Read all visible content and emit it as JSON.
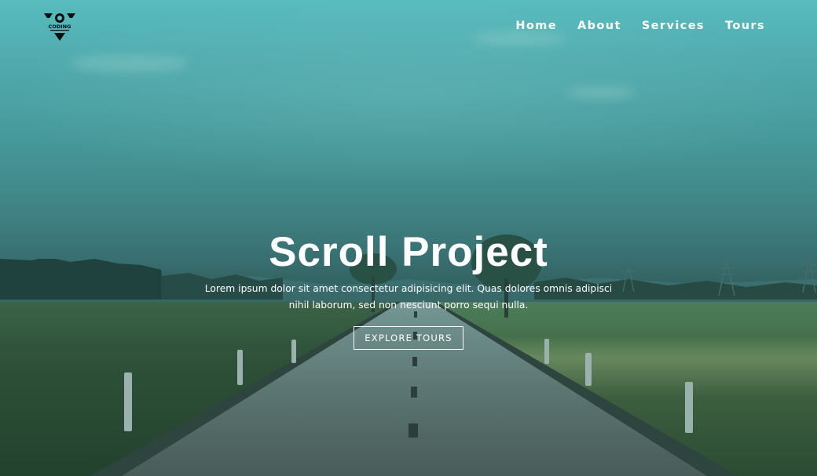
{
  "brand": {
    "logo_text": "CODING"
  },
  "nav": {
    "items": [
      {
        "label": "Home"
      },
      {
        "label": "About"
      },
      {
        "label": "Services"
      },
      {
        "label": "Tours"
      }
    ]
  },
  "hero": {
    "title": "Scroll Project",
    "description": "Lorem ipsum dolor sit amet consectetur adipisicing elit. Quas dolores omnis adipisci nihil laborum, sed non nesciunt porro sequi nulla.",
    "cta_label": "explore tours"
  },
  "colors": {
    "overlay": "#3fa9ab",
    "text": "#ffffff"
  }
}
